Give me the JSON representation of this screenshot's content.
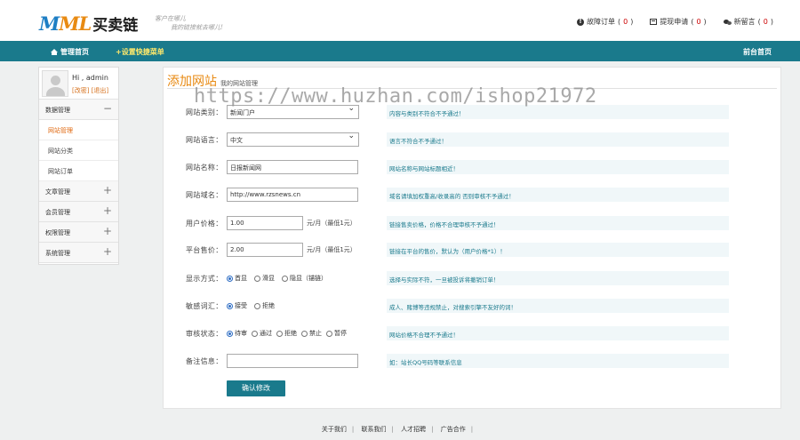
{
  "header": {
    "logo_mark_a": "M",
    "logo_mark_b": "ML",
    "logo_cn": "买卖链",
    "slogan_1": "客户在哪儿",
    "slogan_2": "我的链接就去哪儿!",
    "links": [
      {
        "label": "故障订单",
        "count": "0",
        "icon": "warning-icon"
      },
      {
        "label": "提现申请",
        "count": "0",
        "icon": "card-icon"
      },
      {
        "label": "新留言",
        "count": "0",
        "icon": "chat-icon"
      }
    ]
  },
  "nav": {
    "home": "管理首页",
    "quick": "+设置快捷菜单",
    "front": "前台首页"
  },
  "sidebar": {
    "greeting": "Hi , admin",
    "edit": "[改密]",
    "logout": "[退出]",
    "group_data": "数据管理",
    "items": [
      "网站管理",
      "网站分类",
      "网站订单"
    ],
    "groups": [
      "文章管理",
      "会员管理",
      "权限管理",
      "系统管理"
    ]
  },
  "main": {
    "title": "添加网站",
    "subtitle": "我的网站管理"
  },
  "watermark": "https://www.huzhan.com/ishop21972",
  "form": {
    "category": {
      "label": "网站类别：",
      "value": "新闻门户",
      "hint": "内容与类别不符合不予通过！"
    },
    "language": {
      "label": "网站语言：",
      "value": "中文",
      "hint": "语言不符合不予通过！"
    },
    "name": {
      "label": "网站名称：",
      "value": "日报新闻网",
      "hint": "网站名称与网站标题相近！"
    },
    "domain": {
      "label": "网站域名：",
      "value": "http://www.rzsnews.cn",
      "hint": "域名请填加权重高/收录高的 否则审核不予通过！"
    },
    "user_price": {
      "label": "用户价格：",
      "value": "1.00",
      "unit": "元/月（最低1元）",
      "hint": "链接售卖价格，价格不合理审核不予通过！"
    },
    "platform_price": {
      "label": "平台售价：",
      "value": "2.00",
      "unit": "元/月（最低1元）",
      "hint": "链接在平台的售价，默认为（用户价格*1）！"
    },
    "display": {
      "label": "显示方式：",
      "options": [
        "首显",
        "滑显",
        "隐显（锚链）"
      ],
      "hint": "选择与实际不符，一旦被投诉将撤销订单！"
    },
    "sensitive": {
      "label": "敏感词汇：",
      "options": [
        "接受",
        "拒绝"
      ],
      "hint": "成人、赌博等违规禁止，对搜索引擎不友好的词！"
    },
    "status": {
      "label": "审核状态：",
      "options": [
        "待审",
        "通过",
        "拒绝",
        "禁止",
        "暂停"
      ],
      "hint": "网站价格不合理不予通过！"
    },
    "remark": {
      "label": "备注信息：",
      "value": "",
      "hint": "如：站长QQ号码等联系信息"
    },
    "submit": "确认修改"
  },
  "footer": {
    "links": [
      "关于我们",
      "联系我们",
      "人才招聘",
      "广告合作"
    ]
  }
}
